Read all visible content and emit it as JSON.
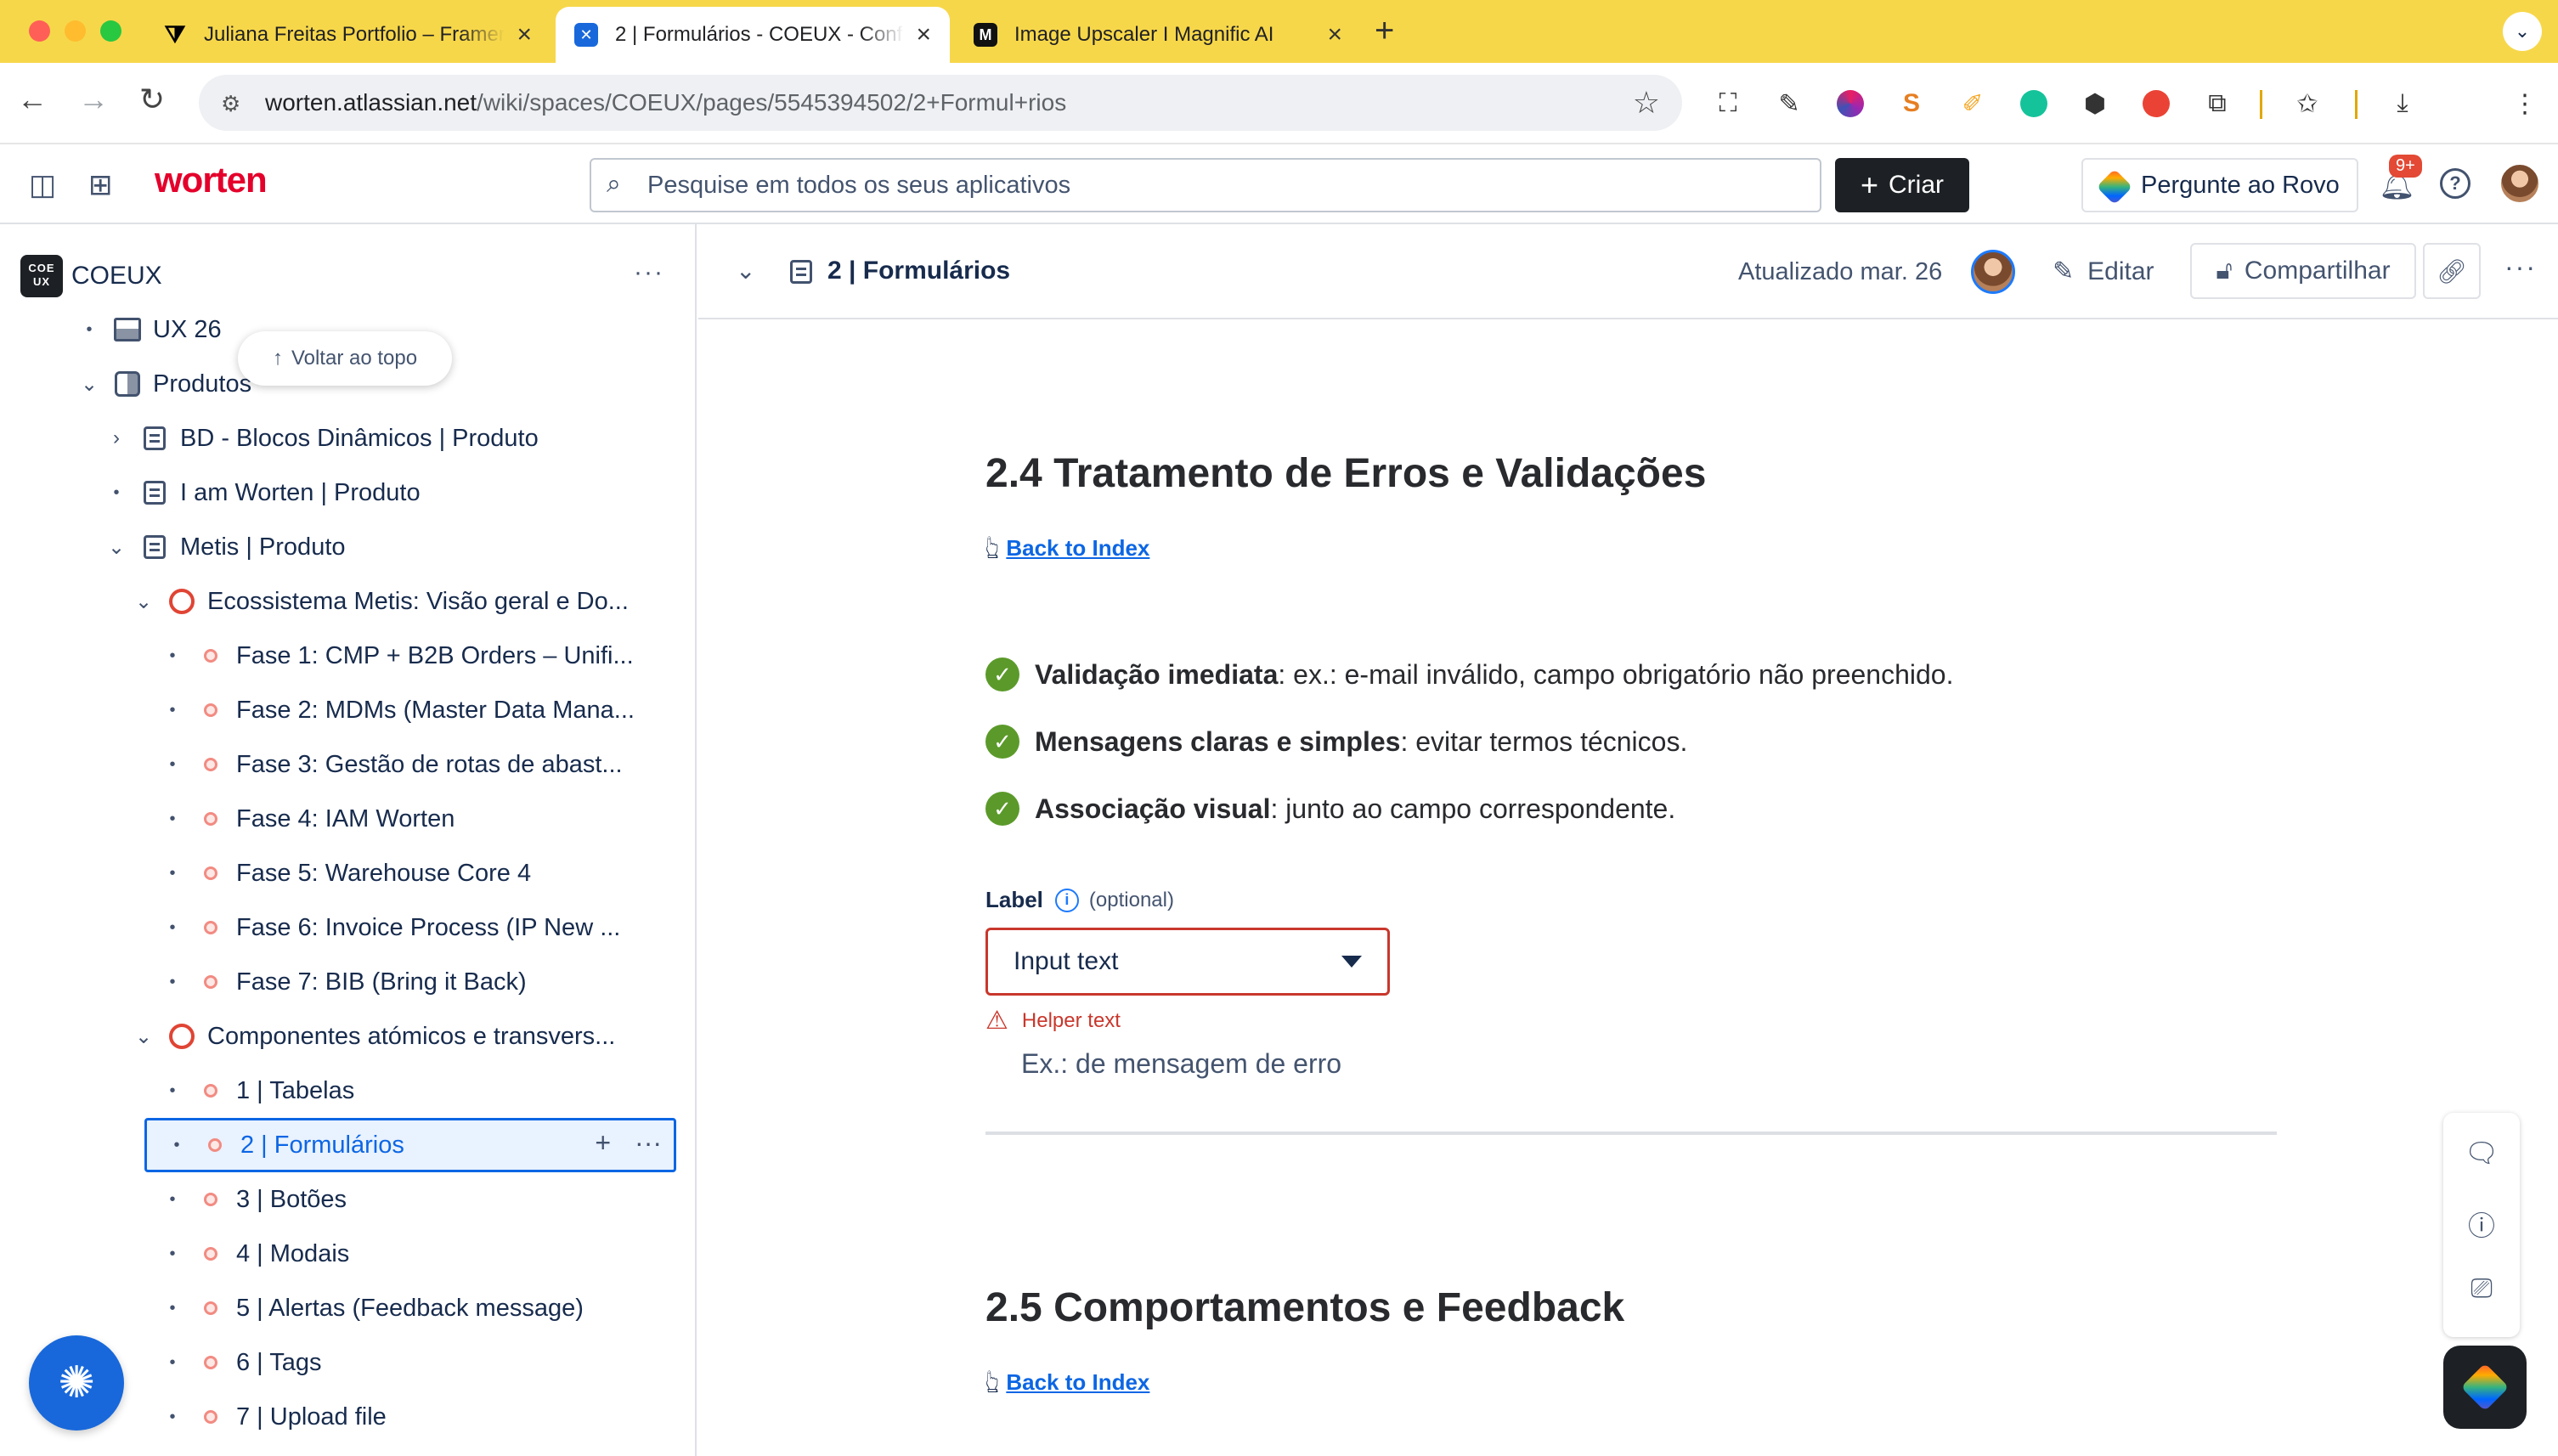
{
  "browser": {
    "tabs": [
      {
        "title": "Juliana Freitas Portfolio – Framer",
        "active": false
      },
      {
        "title": "2 | Formulários - COEUX - Confluence",
        "active": true
      },
      {
        "title": "Image Upscaler I Magnific AI",
        "active": false
      }
    ],
    "url_host": "worten.atlassian.net",
    "url_path": "/wiki/spaces/COEUX/pages/5545394502/2+Formul+rios"
  },
  "appbar": {
    "brand": "worten",
    "search_placeholder": "Pesquise em todos os seus aplicativos",
    "create_label": "Criar",
    "rovo_label": "Pergunte ao Rovo",
    "notifications_badge": "9+"
  },
  "sidebar": {
    "space_logo": "COE UX",
    "space_name": "COEUX",
    "back_to_top": "Voltar ao topo",
    "items": [
      {
        "label": "UX 26"
      },
      {
        "label": "Produtos"
      },
      {
        "label": "BD - Blocos Dinâmicos | Produto"
      },
      {
        "label": "I am Worten | Produto"
      },
      {
        "label": "Metis | Produto"
      },
      {
        "label": "Ecossistema Metis: Visão geral e Do..."
      },
      {
        "label": "Fase 1: CMP + B2B Orders – Unifi..."
      },
      {
        "label": "Fase 2: MDMs (Master Data Mana..."
      },
      {
        "label": "Fase 3: Gestão de rotas de abast..."
      },
      {
        "label": "Fase 4: IAM Worten"
      },
      {
        "label": "Fase 5: Warehouse Core 4"
      },
      {
        "label": "Fase 6: Invoice Process (IP New ..."
      },
      {
        "label": "Fase 7: BIB (Bring it Back)"
      },
      {
        "label": "Componentes atómicos e transvers..."
      },
      {
        "label": "1 | Tabelas"
      },
      {
        "label": "2 | Formulários"
      },
      {
        "label": "3 | Botões"
      },
      {
        "label": "4 | Modais"
      },
      {
        "label": "5 | Alertas (Feedback message)"
      },
      {
        "label": "6 | Tags"
      },
      {
        "label": "7 | Upload file"
      }
    ]
  },
  "page": {
    "title": "2 | Formulários",
    "updated": "Atualizado mar. 26",
    "edit_label": "Editar",
    "share_label": "Compartilhar"
  },
  "article": {
    "section_24_title": "2.4 Tratamento de Erros e Validações",
    "back_to_index": "Back to Index",
    "checks": [
      {
        "bold": "Validação imediata",
        "rest": ": ex.: e-mail inválido, campo obrigatório não preenchido."
      },
      {
        "bold": "Mensagens claras e simples",
        "rest": ": evitar termos técnicos."
      },
      {
        "bold": "Associação visual",
        "rest": ": junto ao campo correspondente."
      }
    ],
    "field_label": "Label",
    "field_optional": "(optional)",
    "field_value": "Input text",
    "helper_text": "Helper text",
    "example_text": "Ex.: de mensagem de erro",
    "section_25_title": "2.5 Comportamentos e Feedback"
  }
}
